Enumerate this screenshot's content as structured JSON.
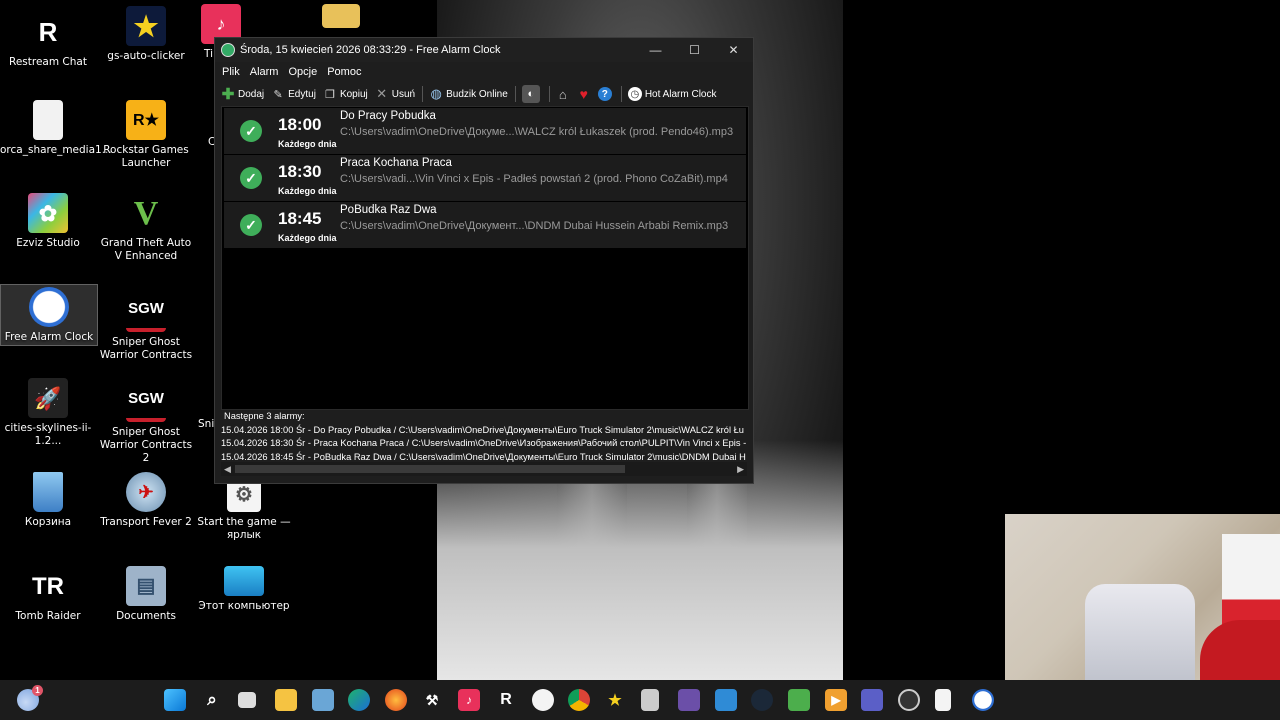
{
  "desktop_icons": [
    {
      "label": "Restream Chat",
      "icon": "restream-icon",
      "glyph": "R"
    },
    {
      "label": "gs-auto-clicker",
      "icon": "star-icon",
      "glyph": "★"
    },
    {
      "label": "orca_share_media1...",
      "icon": "file-icon",
      "glyph": ""
    },
    {
      "label": "Rockstar Games Launcher",
      "icon": "rockstar-icon",
      "glyph": "R★"
    },
    {
      "label": "Ezviz Studio",
      "icon": "ezviz-icon",
      "glyph": "✿"
    },
    {
      "label": "Grand Theft Auto V Enhanced",
      "icon": "gta-icon",
      "glyph": "V"
    },
    {
      "label": "Free Alarm Clock",
      "icon": "alarm-clock-icon",
      "glyph": "⏰"
    },
    {
      "label": "Sniper Ghost Warrior Contracts",
      "icon": "sgw-icon",
      "glyph": "SGW"
    },
    {
      "label": "cities-skylines-ii-1.2...",
      "icon": "rocket-icon",
      "glyph": "🚀"
    },
    {
      "label": "Sniper Ghost Warrior Contracts 2",
      "icon": "sgw2-icon",
      "glyph": "SGW"
    },
    {
      "label": "Корзина",
      "icon": "recycle-bin-icon",
      "glyph": "🗑"
    },
    {
      "label": "Transport Fever 2",
      "icon": "transport-fever-icon",
      "glyph": "✈"
    },
    {
      "label": "Start the game — ярлык",
      "icon": "gears-icon",
      "glyph": "⚙"
    },
    {
      "label": "Tomb Raider",
      "icon": "tomb-raider-icon",
      "glyph": "TR"
    },
    {
      "label": "Documents",
      "icon": "folder-icon",
      "glyph": "▤"
    },
    {
      "label": "Этот компьютер",
      "icon": "monitor-icon",
      "glyph": "▭"
    },
    {
      "label": "Ti",
      "icon": "tiktok-icon",
      "glyph": "♪"
    },
    {
      "label": "C",
      "icon": "partial-icon",
      "glyph": ""
    },
    {
      "label": "Snip",
      "icon": "partial-icon",
      "glyph": ""
    }
  ],
  "window": {
    "title": "Środa, 15 kwiecień 2026 08:33:29 - Free Alarm Clock",
    "controls": {
      "minimize": "—",
      "maximize": "☐",
      "close": "✕"
    },
    "menu": [
      "Plik",
      "Alarm",
      "Opcje",
      "Pomoc"
    ],
    "toolbar": {
      "add": "Dodaj",
      "edit": "Edytuj",
      "copy": "Kopiuj",
      "delete": "Usuń",
      "online": "Budzik Online",
      "hot": "Hot Alarm Clock"
    },
    "alarms": [
      {
        "time": "18:00",
        "repeat": "Każdego dnia",
        "name": "Do Pracy Pobudka",
        "path": "C:\\Users\\vadim\\OneDrive\\Докуме...\\WALCZ król Łukaszek (prod. Pendo46).mp3"
      },
      {
        "time": "18:30",
        "repeat": "Każdego dnia",
        "name": "Praca Kochana Praca",
        "path": "C:\\Users\\vadi...\\Vin Vinci x Epis - Padłeś powstań 2 (prod.  Phono CoZaBit).mp4"
      },
      {
        "time": "18:45",
        "repeat": "Każdego dnia",
        "name": "PoBudka Raz Dwa",
        "path": "C:\\Users\\vadim\\OneDrive\\Документ...\\DNDM  Dubai Hussein Arbabi Remix.mp3"
      }
    ],
    "next_title": "Następne 3 alarmy:",
    "next_lines": [
      "15.04.2026 18:00 Śr - Do Pracy Pobudka / C:\\Users\\vadim\\OneDrive\\Документы\\Euro Truck Simulator 2\\music\\WALCZ król Łu",
      "15.04.2026 18:30 Śr - Praca Kochana Praca / C:\\Users\\vadim\\OneDrive\\Изображения\\Рабочий стол\\PULPIT\\Vin Vinci x Epis - P",
      "15.04.2026 18:45 Śr - PoBudka Raz Dwa / C:\\Users\\vadim\\OneDrive\\Документы\\Euro Truck Simulator 2\\music\\DNDM  Dubai H"
    ]
  },
  "taskbar": {
    "weather_badge": "1",
    "icons": [
      "weather-icon",
      "windows-start-icon",
      "search-icon",
      "task-view-icon",
      "file-explorer-icon",
      "photos-icon",
      "edge-icon",
      "firefox-icon",
      "app-icon",
      "tiktok-icon",
      "restream-icon",
      "app-icon-2",
      "chrome-icon",
      "star-icon",
      "app-icon-3",
      "app-icon-4",
      "gallery-icon",
      "steam-icon",
      "game-icon",
      "media-player-icon",
      "teams-icon",
      "obs-icon",
      "notepad-icon",
      "alarm-clock-icon"
    ]
  }
}
